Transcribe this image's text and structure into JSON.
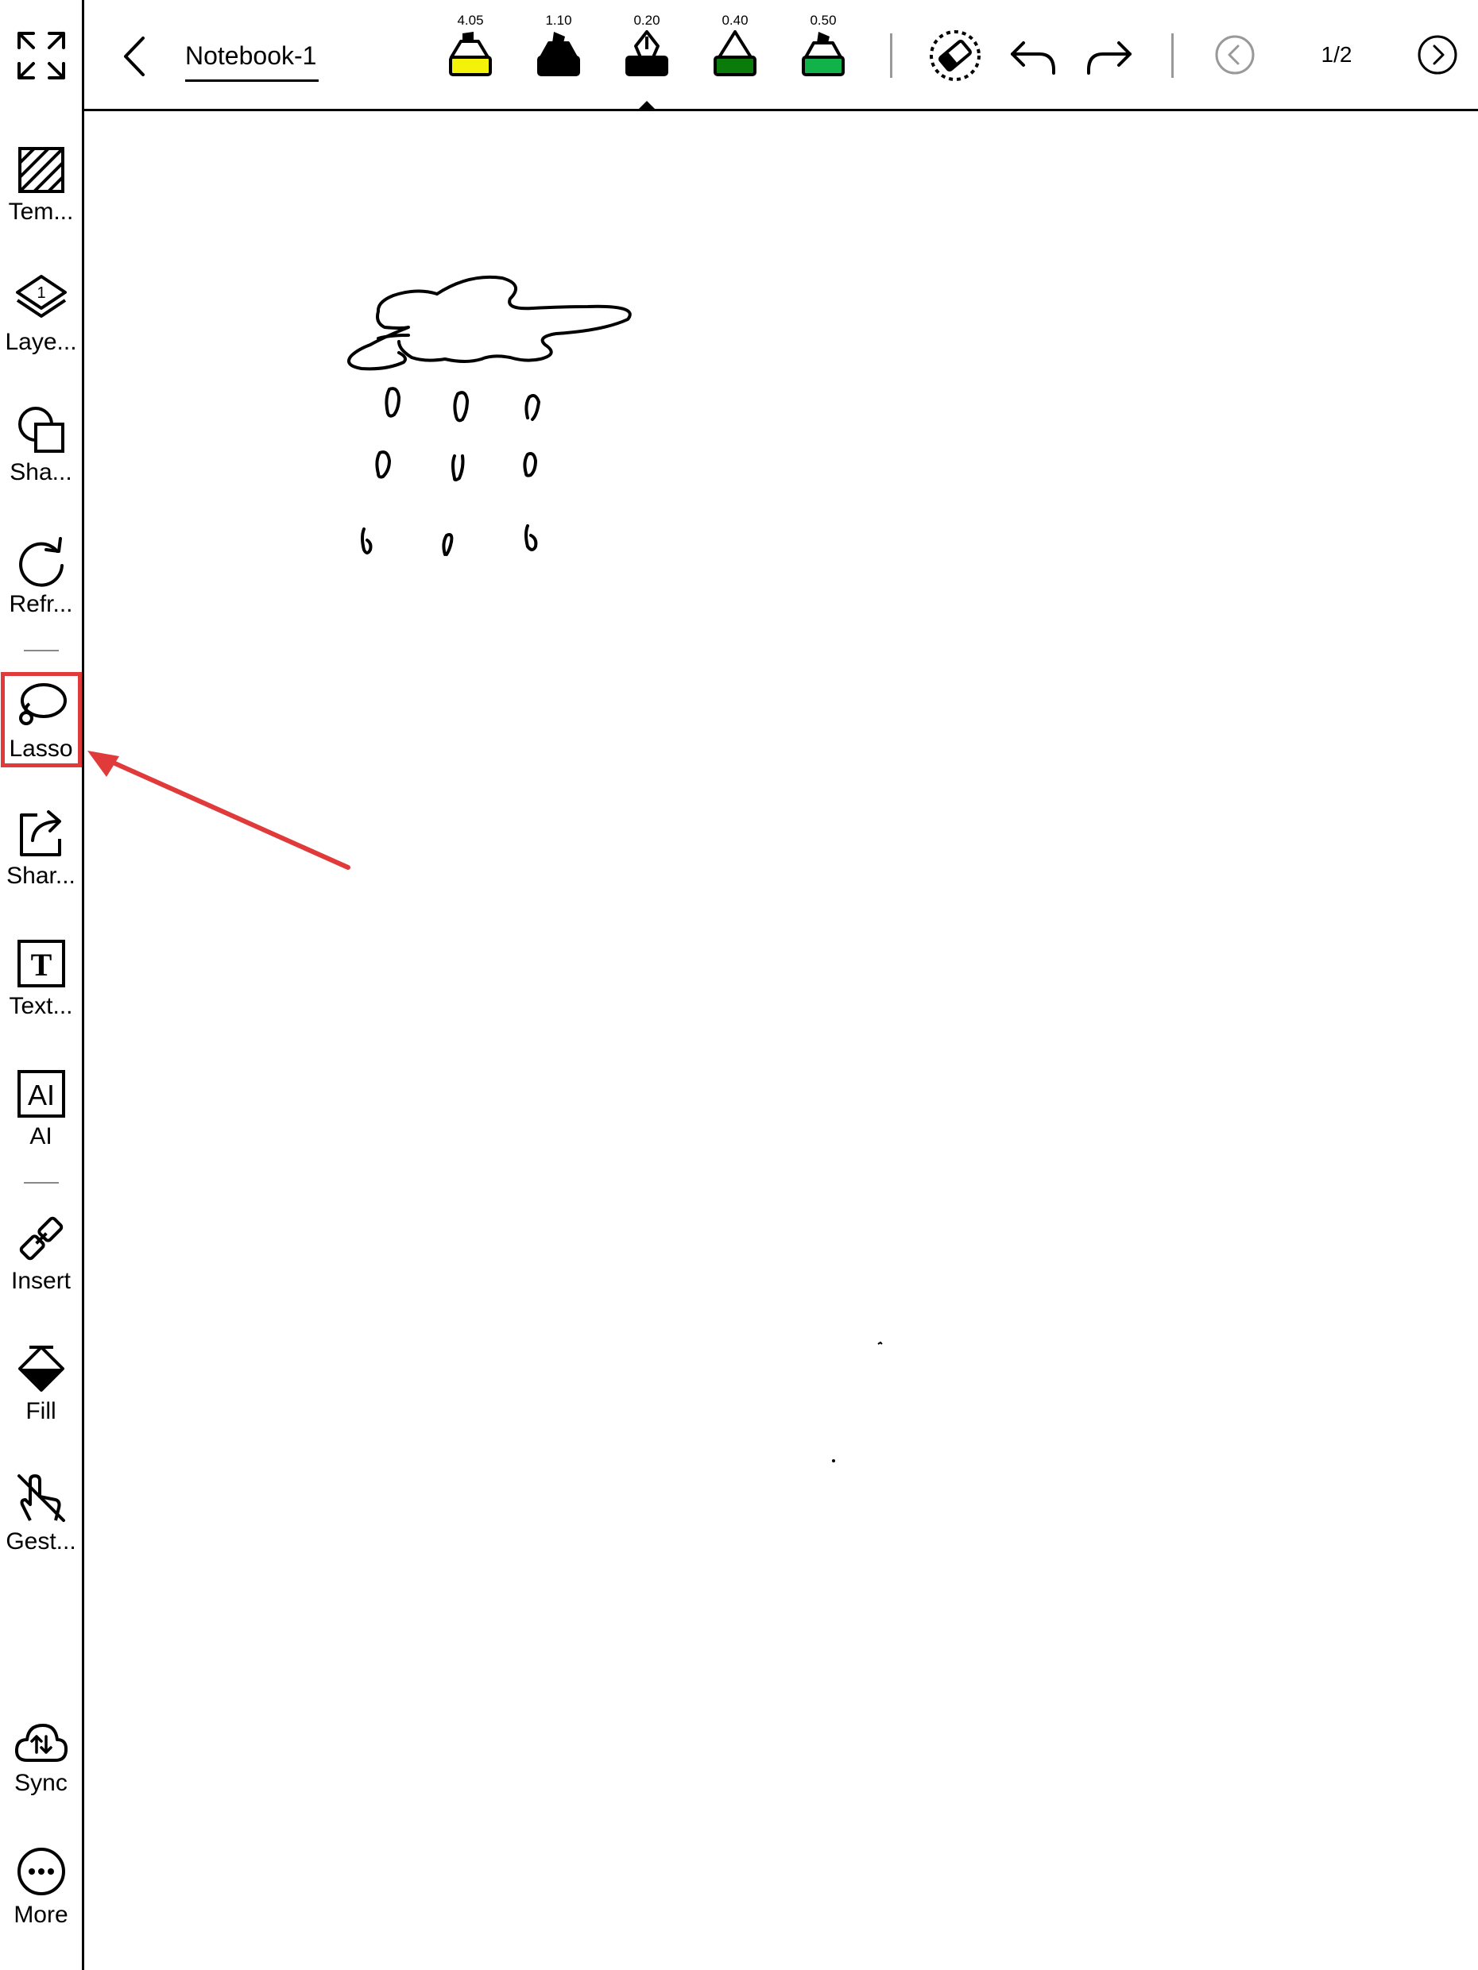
{
  "app": {
    "notebook_title": "Notebook-1",
    "page_indicator": "1/2"
  },
  "pens": [
    {
      "size": "4.05",
      "color": "#f5f20a",
      "type": "highlighter"
    },
    {
      "size": "1.10",
      "color": "#000000",
      "type": "marker"
    },
    {
      "size": "0.20",
      "color": "#000000",
      "type": "fountain-pen",
      "selected": true
    },
    {
      "size": "0.40",
      "color": "#0a7a0a",
      "type": "ballpoint"
    },
    {
      "size": "0.50",
      "color": "#12b24a",
      "type": "marker"
    }
  ],
  "sidebar": {
    "items": [
      {
        "label": "Tem...",
        "icon": "template-icon"
      },
      {
        "label": "Laye...",
        "icon": "layers-icon",
        "badge": "1"
      },
      {
        "label": "Sha...",
        "icon": "shapes-icon"
      },
      {
        "label": "Refr...",
        "icon": "refresh-icon"
      },
      {
        "label": "Lasso",
        "icon": "lasso-icon",
        "highlighted": true
      },
      {
        "label": "Shar...",
        "icon": "share-icon"
      },
      {
        "label": "Text...",
        "icon": "text-box-icon",
        "glyph": "T"
      },
      {
        "label": "AI",
        "icon": "ai-icon",
        "glyph": "AI"
      },
      {
        "label": "Insert",
        "icon": "insert-link-icon"
      },
      {
        "label": "Fill",
        "icon": "fill-bucket-icon"
      },
      {
        "label": "Gest...",
        "icon": "gesture-icon"
      },
      {
        "label": "Sync",
        "icon": "cloud-sync-icon"
      },
      {
        "label": "More",
        "icon": "more-icon"
      }
    ]
  },
  "annotation": {
    "highlight_color": "#e03a3a"
  }
}
